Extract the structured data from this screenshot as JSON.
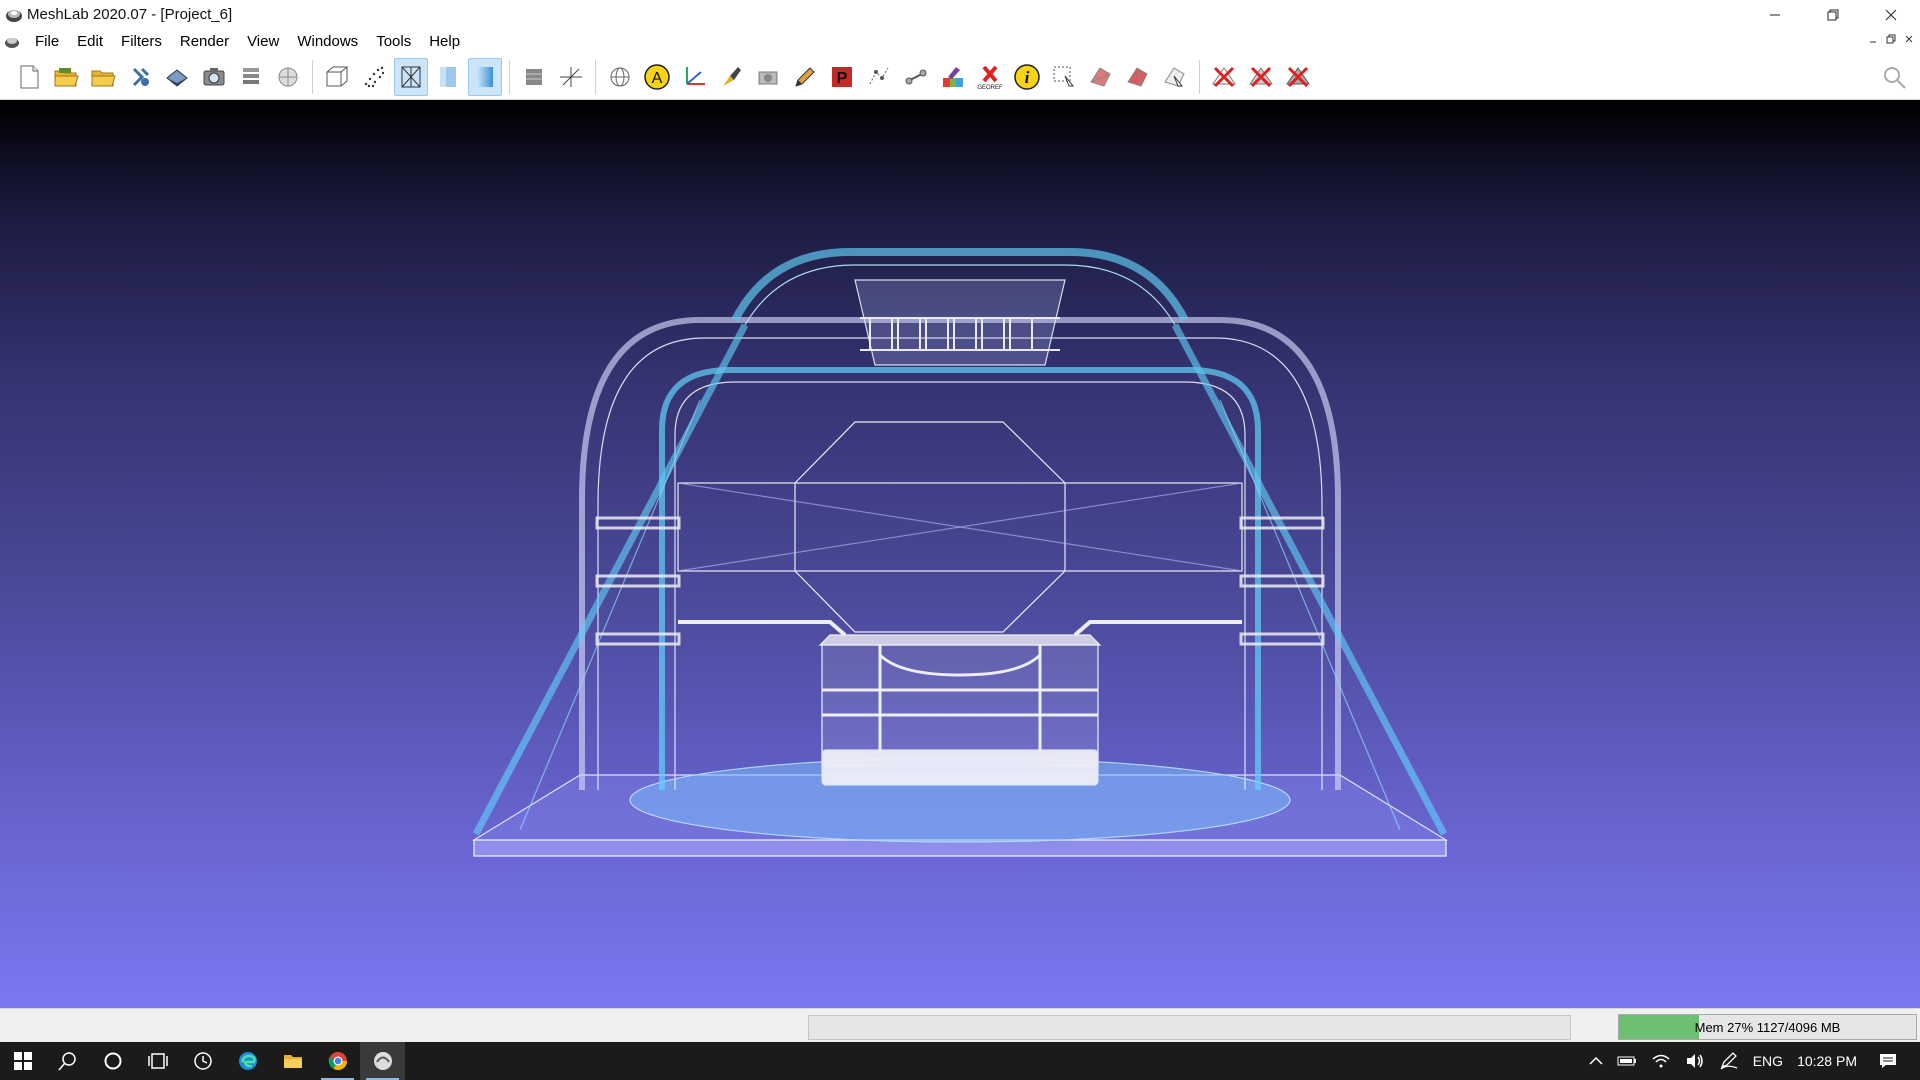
{
  "window": {
    "title": "MeshLab 2020.07 - [Project_6]"
  },
  "menubar": {
    "items": [
      "File",
      "Edit",
      "Filters",
      "Render",
      "View",
      "Windows",
      "Tools",
      "Help"
    ]
  },
  "toolbar": {
    "groups": [
      [
        "new-project-icon",
        "open-project-icon",
        "import-mesh-icon",
        "reload-icon",
        "save-mesh-icon",
        "snapshot-icon",
        "layer-stack-icon",
        "raster-icon"
      ],
      [
        "bounding-box-icon",
        "points-icon",
        "wireframe-icon",
        "flat-shading-icon",
        "smooth-shading-icon"
      ],
      [
        "decorate-icon",
        "axis-icon"
      ],
      [
        "trackball-icon",
        "annotate-icon",
        "xyz-axes-icon",
        "paint-brush-select-icon",
        "camera-icon",
        "pencil-icon",
        "pickpoints-icon",
        "align-icon",
        "measure-icon",
        "color-paint-icon",
        "georef-icon",
        "info-icon",
        "select-faces-icon",
        "select-vertices-icon",
        "select-connected-icon",
        "select-region-icon"
      ],
      [
        "delete-vertices-icon",
        "delete-faces-icon",
        "delete-all-icon"
      ]
    ],
    "active": [
      "wireframe-icon",
      "smooth-shading-icon"
    ]
  },
  "statusbar": {
    "memory_label": "Mem 27% 1127/4096 MB",
    "memory_fraction": 0.27
  },
  "taskbar": {
    "apps": [
      "start-icon",
      "search-icon",
      "cortana-icon",
      "task-view-icon",
      "clock-app-icon",
      "edge-icon",
      "file-explorer-icon",
      "chrome-icon",
      "meshlab-icon"
    ],
    "tray": {
      "language": "ENG",
      "time": "10:28 PM"
    }
  },
  "colors": {
    "viewport_top": "#000000",
    "viewport_bottom": "#7b78f2",
    "mesh_wire": "#e8f4ff",
    "mesh_accent": "#66d9ff",
    "memory_fill": "#6fbf73"
  }
}
